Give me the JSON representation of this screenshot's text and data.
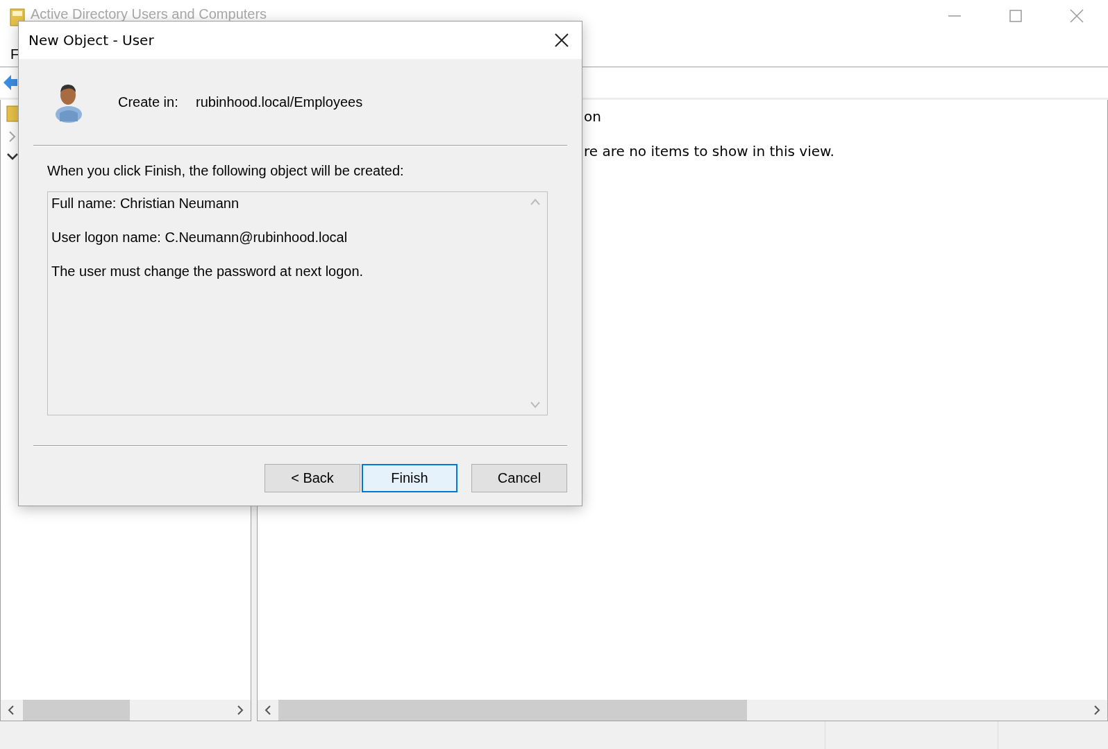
{
  "window": {
    "title": "Active Directory Users and Computers",
    "menu": [
      "F"
    ]
  },
  "details_pane": {
    "lines": [
      "on",
      "re are no items to show in this view."
    ]
  },
  "dialog": {
    "title": "New Object - User",
    "create_in_label": "Create in:",
    "create_in_path": "rubinhood.local/Employees",
    "intro": "When you click Finish, the following object will be created:",
    "summary": [
      "Full name: Christian Neumann",
      "User logon name: C.Neumann@rubinhood.local",
      "The user must change the password at next logon."
    ],
    "buttons": [
      {
        "label": "< Back",
        "default": false
      },
      {
        "label": "Finish",
        "default": true
      },
      {
        "label": "Cancel",
        "default": false
      }
    ]
  }
}
